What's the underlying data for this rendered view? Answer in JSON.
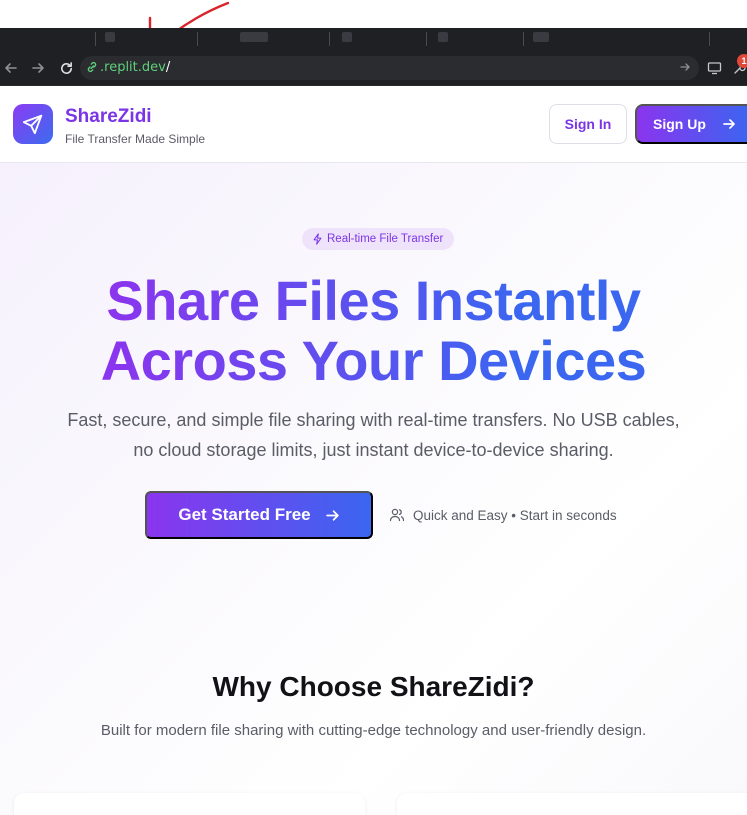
{
  "browser": {
    "url_host": ".replit.dev",
    "url_path": "/",
    "notification_count": "1"
  },
  "header": {
    "brand_name": "ShareZidi",
    "brand_tagline": "File Transfer Made Simple",
    "sign_in_label": "Sign In",
    "sign_up_label": "Sign Up"
  },
  "hero": {
    "badge_label": "Real-time File Transfer",
    "headline_line1": "Share Files Instantly",
    "headline_line2": "Across Your Devices",
    "subtext_line1": "Fast, secure, and simple file sharing with real-time transfers. No USB cables,",
    "subtext_line2": "no cloud storage limits, just instant device-to-device sharing.",
    "cta_label": "Get Started Free",
    "quick_text": "Quick and Easy • Start in seconds"
  },
  "why": {
    "title": "Why Choose ShareZidi?",
    "subtitle": "Built for modern file sharing with cutting-edge technology and user-friendly design."
  },
  "colors": {
    "brand_purple": "#7b35e6",
    "brand_blue": "#3a66f0",
    "annotation_red": "#d8242a"
  },
  "icons": {
    "logo": "paper-plane-icon",
    "badge": "lightning-icon",
    "quick": "users-icon",
    "cta": "arrow-right-icon",
    "annotation": "hand-drawn-arrow"
  }
}
